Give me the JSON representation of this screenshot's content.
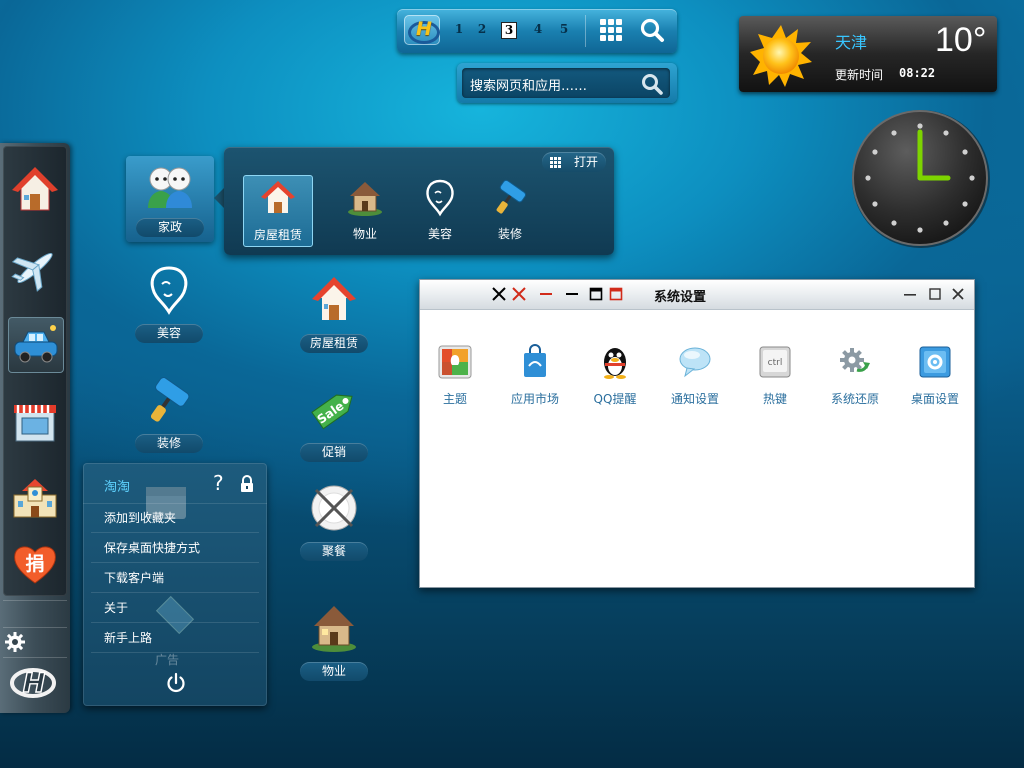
{
  "topbar": {
    "logo_letter": "H",
    "pages": [
      "1",
      "2",
      "3",
      "4",
      "5"
    ],
    "active_page": 3
  },
  "search": {
    "placeholder": "搜索网页和应用……"
  },
  "weather": {
    "city": "天津",
    "temperature": "10°",
    "update_label": "更新时间",
    "update_time": "08:22"
  },
  "clock": {
    "hour": 3,
    "minute": 0
  },
  "dock": {
    "items": [
      {
        "icon": "home-icon"
      },
      {
        "icon": "airplane-icon"
      },
      {
        "icon": "car-icon",
        "selected": true
      },
      {
        "icon": "shop-icon"
      },
      {
        "icon": "school-icon"
      },
      {
        "icon": "donate-heart-icon",
        "text": "捐"
      }
    ],
    "settings_icon": "gear-icon",
    "logo_letter": "H"
  },
  "folder": {
    "name": "家政",
    "open_label": "打开",
    "items": [
      {
        "label": "房屋租赁",
        "icon": "house-icon",
        "selected": true
      },
      {
        "label": "物业",
        "icon": "cottage-icon"
      },
      {
        "label": "美容",
        "icon": "beauty-icon"
      },
      {
        "label": "装修",
        "icon": "paint-roller-icon"
      }
    ]
  },
  "desktop": {
    "icons": [
      {
        "label": "美容",
        "icon": "beauty-icon"
      },
      {
        "label": "房屋租赁",
        "icon": "house-icon"
      },
      {
        "label": "装修",
        "icon": "paint-roller-icon"
      },
      {
        "label": "促销",
        "icon": "sale-tag-icon",
        "tag_text": "Sale"
      },
      {
        "label": "聚餐",
        "icon": "dining-plate-icon"
      },
      {
        "label": "物业",
        "icon": "cottage-icon"
      },
      {
        "label": "广告",
        "icon": "film-icon"
      }
    ]
  },
  "settings_window": {
    "title": "系统设置",
    "items": [
      {
        "label": "主题",
        "icon": "theme-icon"
      },
      {
        "label": "应用市场",
        "icon": "app-market-icon"
      },
      {
        "label": "QQ提醒",
        "icon": "qq-penguin-icon"
      },
      {
        "label": "通知设置",
        "icon": "speech-bubble-icon"
      },
      {
        "label": "热键",
        "icon": "ctrl-key-icon",
        "key_text": "ctrl"
      },
      {
        "label": "系统还原",
        "icon": "gear-restore-icon"
      },
      {
        "label": "桌面设置",
        "icon": "desktop-settings-icon"
      }
    ]
  },
  "start_menu": {
    "user": "淘淘",
    "help": "?",
    "items": [
      "添加到收藏夹",
      "保存桌面快捷方式",
      "下载客户端",
      "关于",
      "新手上路"
    ]
  }
}
